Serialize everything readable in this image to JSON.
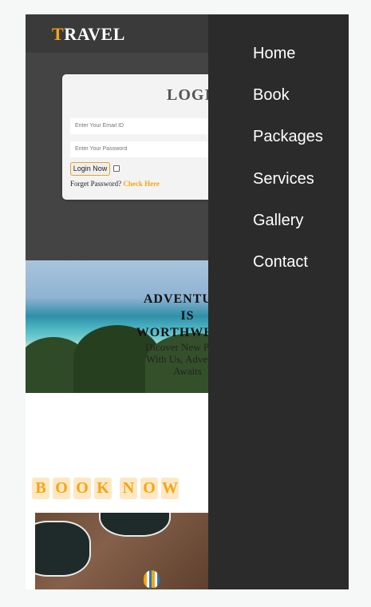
{
  "header": {
    "logo_first": "T",
    "logo_rest": "RAVEL"
  },
  "login": {
    "title": "LOGIN",
    "email_placeholder": "Enter Your Email ID",
    "password_placeholder": "Enter Your Password",
    "button_label": "Login Now",
    "forgot_text": "Forget Password?",
    "check_here": "Check Here"
  },
  "hero": {
    "title_line1": "ADVENTURE",
    "title_line2": "IS",
    "title_line3": "WORTHWHILE",
    "subtitle_line1": "Dicover New Places",
    "subtitle_line2": "With Us, Adventure",
    "subtitle_line3": "Awaits"
  },
  "book_now": {
    "letters": [
      "B",
      "O",
      "O",
      "K",
      "N",
      "O",
      "W"
    ]
  },
  "menu": {
    "items": [
      "Home",
      "Book",
      "Packages",
      "Services",
      "Gallery",
      "Contact"
    ]
  },
  "colors": {
    "accent": "#f5a513",
    "header_bg": "#3a3a3a",
    "menu_bg": "#2b2b2b"
  }
}
